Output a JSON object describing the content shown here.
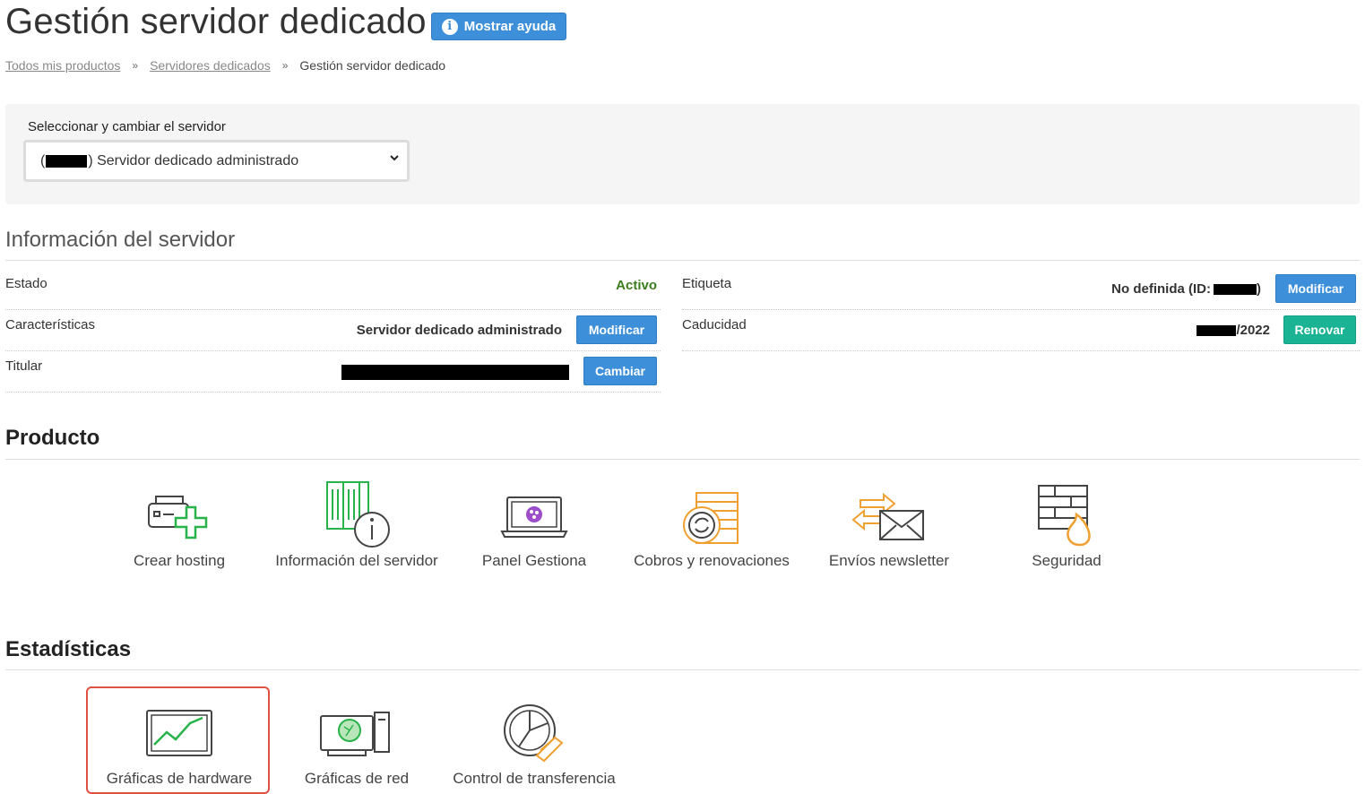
{
  "header": {
    "title": "Gestión servidor dedicado",
    "help_button": "Mostrar ayuda",
    "help_icon": "i"
  },
  "breadcrumb": {
    "items": [
      "Todos mis productos",
      "Servidores dedicados",
      "Gestión servidor dedicado"
    ],
    "separator": "»"
  },
  "server_selector": {
    "label": "Seleccionar y cambiar el servidor",
    "prefix": "(",
    "selected": ") Servidor dedicado administrado"
  },
  "server_info": {
    "title": "Información del servidor",
    "estado_label": "Estado",
    "estado_value": "Activo",
    "caracteristicas_label": "Características",
    "caracteristicas_value": "Servidor dedicado administrado",
    "caracteristicas_button": "Modificar",
    "titular_label": "Titular",
    "titular_button": "Cambiar",
    "etiqueta_label": "Etiqueta",
    "etiqueta_value_prefix": "No definida (ID:",
    "etiqueta_value_suffix": ")",
    "etiqueta_button": "Modificar",
    "caducidad_label": "Caducidad",
    "caducidad_value": "/2022",
    "caducidad_button": "Renovar"
  },
  "producto": {
    "title": "Producto",
    "tiles": [
      {
        "label": "Crear hosting",
        "icon": "server-add-icon"
      },
      {
        "label": "Información del servidor",
        "icon": "server-info-icon"
      },
      {
        "label": "Panel Gestiona",
        "icon": "laptop-panel-icon"
      },
      {
        "label": "Cobros y renovaciones",
        "icon": "billing-icon"
      },
      {
        "label": "Envíos newsletter",
        "icon": "newsletter-icon"
      },
      {
        "label": "Seguridad",
        "icon": "firewall-icon"
      }
    ]
  },
  "estadisticas": {
    "title": "Estadísticas",
    "tiles": [
      {
        "label": "Gráficas de hardware",
        "icon": "hardware-chart-icon"
      },
      {
        "label": "Gráficas de red",
        "icon": "network-chart-icon"
      },
      {
        "label": "Control de transferencia",
        "icon": "transfer-pie-icon"
      }
    ]
  },
  "colors": {
    "primary_button": "#3d8fd9",
    "renew_button": "#1ab394",
    "active_status": "#3a7d1c",
    "highlight": "#e05040"
  }
}
